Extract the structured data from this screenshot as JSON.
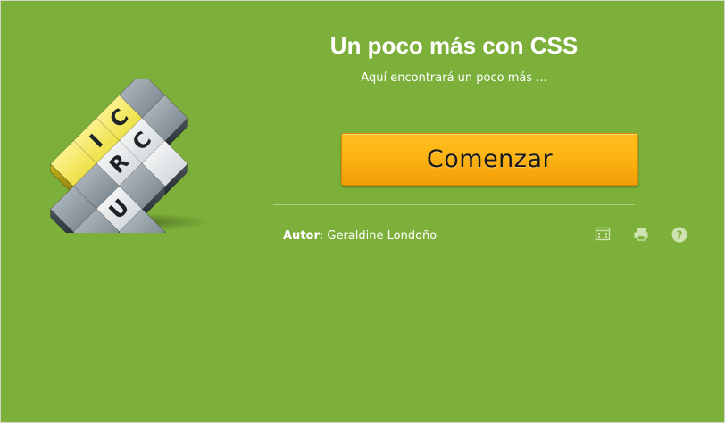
{
  "app": {
    "title": "Un poco más con CSS",
    "subtitle": "Aquí encontrará un poco más ..."
  },
  "actions": {
    "start_label": "Comenzar"
  },
  "author": {
    "label": "Autor",
    "separator": ": ",
    "name": "Geraldine Londoño"
  },
  "logo": {
    "letters": [
      "C",
      "R",
      "U",
      "C",
      "I"
    ],
    "icon": "crossword-logo-icon"
  },
  "toolbar": {
    "icons": [
      "fullscreen-icon",
      "print-icon",
      "help-icon"
    ]
  },
  "colors": {
    "background": "#7db03a",
    "button": "#fdb414",
    "highlight_tile": "#f3e54a",
    "tile": "#8b969e"
  }
}
